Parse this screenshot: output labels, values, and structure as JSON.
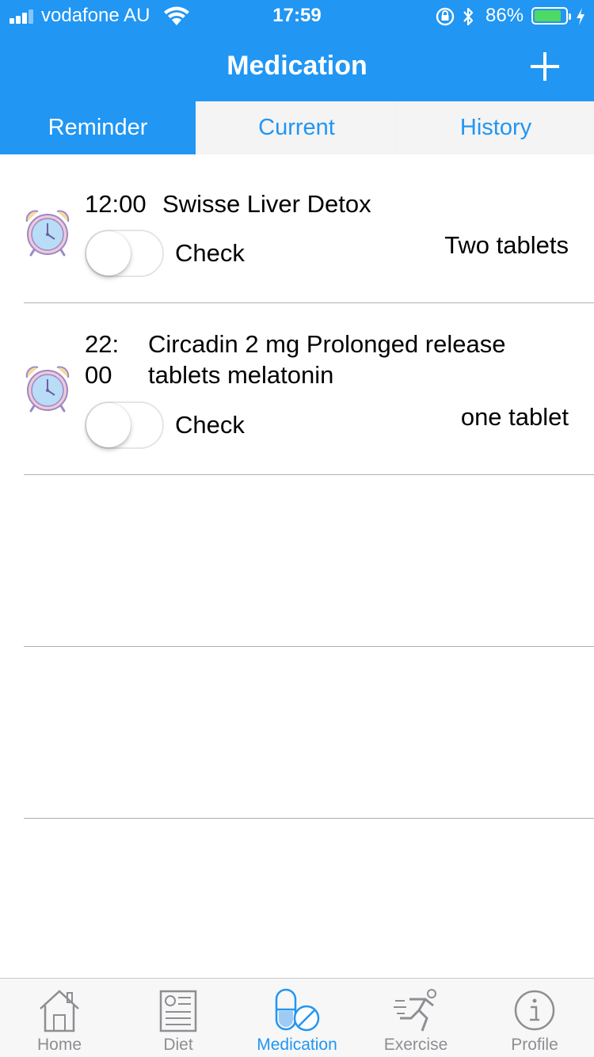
{
  "status_bar": {
    "carrier": "vodafone AU",
    "time": "17:59",
    "battery_percent": "86%",
    "battery_level": 0.86,
    "icons": [
      "signal-icon",
      "wifi-icon",
      "rotation-lock-icon",
      "bluetooth-icon",
      "battery-icon",
      "charging-icon"
    ]
  },
  "header": {
    "title": "Medication",
    "add_icon": "plus-icon"
  },
  "tabs": [
    {
      "label": "Reminder",
      "active": true
    },
    {
      "label": "Current",
      "active": false
    },
    {
      "label": "History",
      "active": false
    }
  ],
  "reminders": [
    {
      "time": "12:00",
      "name": "Swisse Liver Detox",
      "dose": "Two tablets",
      "check_label": "Check",
      "checked": false,
      "icon": "alarm-clock-icon"
    },
    {
      "time": "22:00",
      "time_lines": [
        "22:",
        "00"
      ],
      "name": "Circadin 2 mg Prolonged release tablets melatonin",
      "name_lines": [
        "Circadin 2 mg Prolonged release",
        "tablets melatonin"
      ],
      "dose": "one tablet",
      "check_label": "Check",
      "checked": false,
      "icon": "alarm-clock-icon"
    }
  ],
  "tab_bar": [
    {
      "label": "Home",
      "icon": "house-icon",
      "active": false
    },
    {
      "label": "Diet",
      "icon": "diet-sheet-icon",
      "active": false
    },
    {
      "label": "Medication",
      "icon": "pill-icon",
      "active": true
    },
    {
      "label": "Exercise",
      "icon": "runner-icon",
      "active": false
    },
    {
      "label": "Profile",
      "icon": "info-icon",
      "active": false
    }
  ],
  "colors": {
    "primary": "#2196f3",
    "inactive_tab": "#8e8e93",
    "battery_fill": "#4cd964",
    "divider": "#b0b0b0"
  }
}
